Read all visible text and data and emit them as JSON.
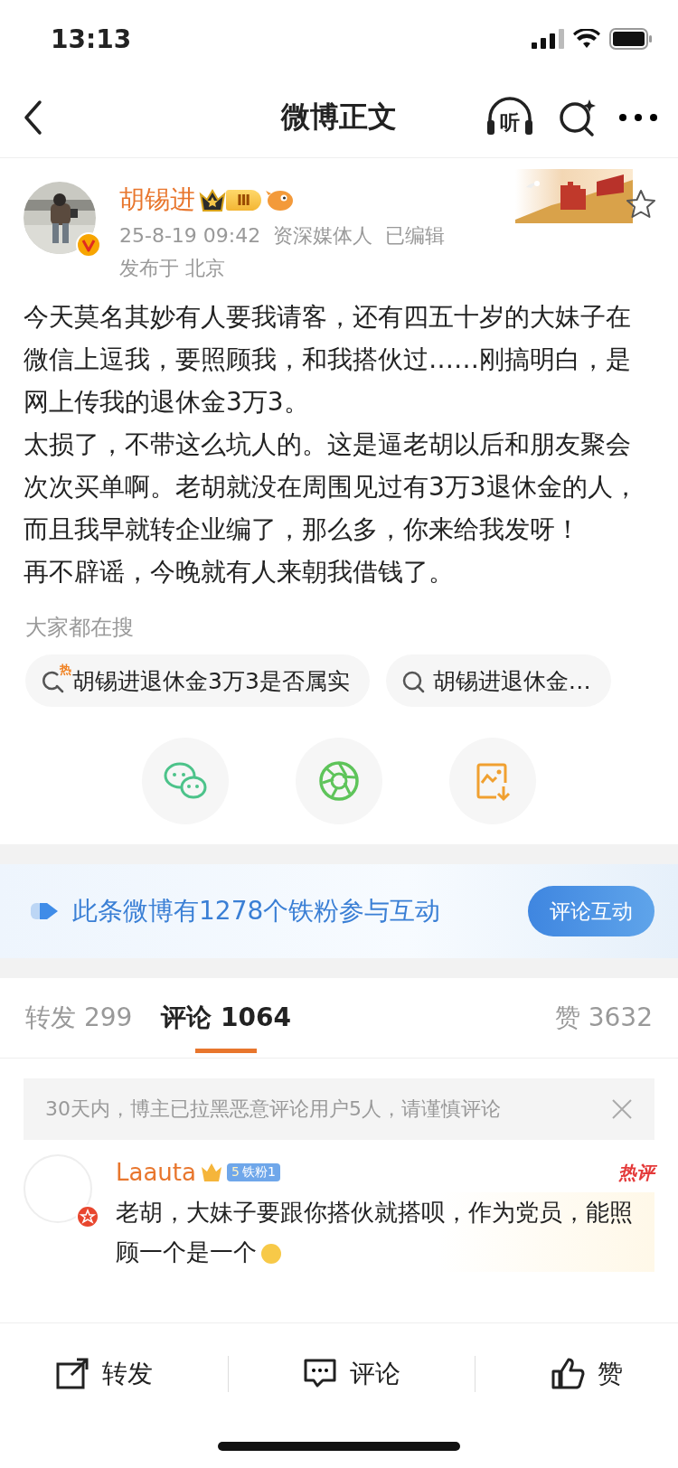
{
  "status_bar": {
    "time": "13:13"
  },
  "nav": {
    "title": "微博正文",
    "listen_label": "听"
  },
  "post": {
    "author": "胡锡进",
    "level_badge": "Ⅲ",
    "verified": true,
    "time": "25-8-19 09:42",
    "tag": "资深媒体人",
    "edited": "已编辑",
    "location": "发布于 北京",
    "favorited": false,
    "paragraphs": [
      "今天莫名其妙有人要我请客，还有四五十岁的大妹子在微信上逗我，要照顾我，和我搭伙过……刚搞明白，是网上传我的退休金3万3。",
      "太损了，不带这么坑人的。这是逼老胡以后和朋友聚会次次买单啊。老胡就没在周围见过有3万3退休金的人，而且我早就转企业编了，那么多，你来给我发呀！",
      "再不辟谣，今晚就有人来朝我借钱了。"
    ]
  },
  "search": {
    "heading": "大家都在搜",
    "chips": [
      {
        "text": "胡锡进退休金3万3是否属实",
        "hot": true,
        "hot_label": "热"
      },
      {
        "text": "胡锡进退休金…",
        "hot": false
      }
    ]
  },
  "banner": {
    "text": "此条微博有1278个铁粉参与互动",
    "button": "评论互动"
  },
  "tabs": [
    {
      "label": "转发",
      "count": "299",
      "selected": false
    },
    {
      "label": "评论",
      "count": "1064",
      "selected": true
    },
    {
      "label": "赞",
      "count": "3632",
      "selected": false
    }
  ],
  "notice": {
    "text": "30天内，博主已拉黑恶意评论用户5人，请谨慎评论"
  },
  "comments": [
    {
      "user": "Laauta",
      "fan_badge": "铁粉1",
      "fan_level": "5",
      "hot_label": "热评",
      "text": "老胡，大妹子要跟你搭伙就搭呗，作为党员，能照顾一个是一个"
    }
  ],
  "actions": [
    {
      "kind": "repost",
      "label": "转发"
    },
    {
      "kind": "comment",
      "label": "评论"
    },
    {
      "kind": "like",
      "label": "赞"
    }
  ]
}
